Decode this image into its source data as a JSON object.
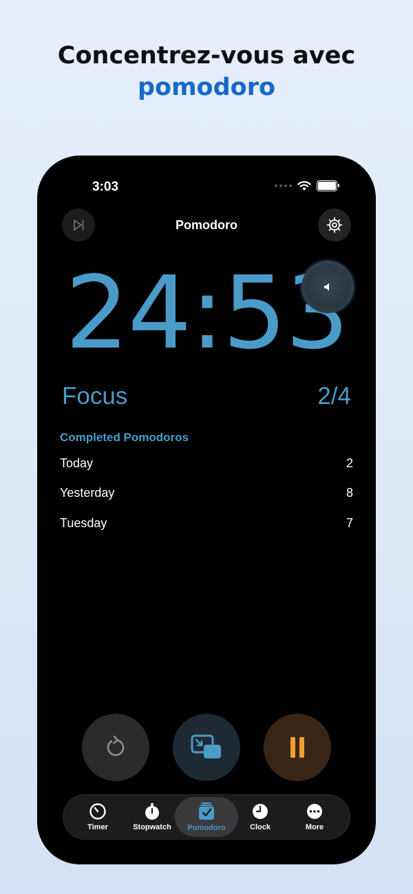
{
  "headline": {
    "line1": "Concentrez-vous avec",
    "line2": "pomodoro"
  },
  "status_bar": {
    "time": "3:03"
  },
  "nav": {
    "title": "Pomodoro"
  },
  "timer": {
    "display": "24:53"
  },
  "session": {
    "mode": "Focus",
    "progress": "2/4"
  },
  "completed": {
    "title": "Completed Pomodoros",
    "rows": [
      {
        "label": "Today",
        "count": "2"
      },
      {
        "label": "Yesterday",
        "count": "8"
      },
      {
        "label": "Tuesday",
        "count": "7"
      }
    ]
  },
  "tabs": [
    {
      "label": "Timer",
      "icon": "timer-icon"
    },
    {
      "label": "Stopwatch",
      "icon": "stopwatch-icon"
    },
    {
      "label": "Pomodoro",
      "icon": "pomodoro-icon",
      "active": true
    },
    {
      "label": "Clock",
      "icon": "clock-icon"
    },
    {
      "label": "More",
      "icon": "more-icon"
    }
  ],
  "colors": {
    "accent": "#4a9bc8",
    "headline_blue": "#1669c8",
    "pause_orange": "#f0a030",
    "background": "#000000"
  }
}
